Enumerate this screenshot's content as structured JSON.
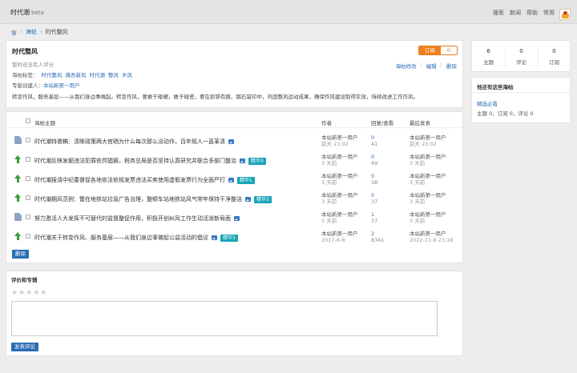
{
  "topbar": {
    "brand": "时代潮",
    "beta": "beta",
    "nav": [
      "搜索",
      "新闻",
      "帮助",
      "常用"
    ]
  },
  "breadcrumb": {
    "items": [
      "海帖",
      "时代整风"
    ],
    "separator": "›"
  },
  "group": {
    "title": "时代整风",
    "rating_text": "暂时还没有人评分",
    "tags_label": "海帖标签：",
    "tags": [
      "时代整风",
      "偶吾新风",
      "时代潮",
      "整风",
      "乡风"
    ],
    "creator_label": "专版创建人：",
    "creator": "本站新第一用户",
    "description": "转变作风，服务基层——从我们身边事做起。转变作风，要敢于碰硬，敢于碰瓷，要在抓铁有痕、踏石留印中，巩固整风运动成果，确保作风建设取得实效，持续改进工作作风。",
    "subscribe_label": "订阅",
    "subscribe_count": "0",
    "actions": [
      "海帖修改",
      "编辑",
      "删除"
    ]
  },
  "list": {
    "headers": {
      "topic": "海帖主题",
      "author": "作者",
      "replies": "回复/查看",
      "last": "最后发表"
    },
    "rows": [
      {
        "icon": "doc-icon",
        "title": "时代潮特邀稿：清晰政策两大官晒为什么每次那么没动作，百年规人一直革清",
        "badge": "",
        "author": "本站新第一用户",
        "author_time": "前天 23:02",
        "replies": "0",
        "views": "41",
        "last_user": "本站新第一用户",
        "last_time": "前天 23:02"
      },
      {
        "icon": "up-icon",
        "title": "时代潮反映发掘违法犯罪依然猖獗，税务总局是否坚持认真研究并联合多部门整治",
        "badge": "精华3",
        "author": "本站新第一用户",
        "author_time": "3 天前",
        "replies": "0",
        "views": "49",
        "last_user": "本站新第一用户",
        "last_time": "3 天前"
      },
      {
        "icon": "up-icon",
        "title": "时代潮报请中纪委督促各地依法依规发票违法买卖使用虚假发票行为全面严打",
        "badge": "精华1",
        "author": "本站新第一用户",
        "author_time": "3 天前",
        "replies": "0",
        "views": "38",
        "last_user": "本站新第一用户",
        "last_time": "3 天前"
      },
      {
        "icon": "up-icon",
        "title": "时代潮拥风范例：警在地铁站垃圾广告治理，整顿车站地铁站风气常年保持干净整洁",
        "badge": "精华3",
        "author": "本站新第一用户",
        "author_time": "3 天前",
        "replies": "0",
        "views": "37",
        "last_user": "本站新第一用户",
        "last_time": "3 天前"
      },
      {
        "icon": "doc-icon",
        "title": "努力激活人大发挥不可替代的监督整促作用，积极开创纠风工作生动活泼新局面",
        "badge": "",
        "author": "本站新第一用户",
        "author_time": "5 天前",
        "replies": "1",
        "views": "37",
        "last_user": "本站新第一用户",
        "last_time": "3 天前"
      },
      {
        "icon": "up-icon",
        "title": "时代潮关于转变作风、服务基层——从我们身边事做起公益活动的倡议",
        "badge": "精华3",
        "author": "本站新第一用户",
        "author_time": "2017-6-8",
        "replies": "2",
        "views": "8341",
        "last_user": "本站新第一用户",
        "last_time": "2022-11-8 23:18"
      }
    ],
    "delete_label": "删除"
  },
  "comment": {
    "title": "评价和专辑",
    "stars": 5,
    "placeholder": "",
    "submit_label": "发表评论"
  },
  "stats": [
    {
      "value": "6",
      "label": "主题"
    },
    {
      "value": "0",
      "label": "评论"
    },
    {
      "value": "0",
      "label": "订阅"
    }
  ],
  "related": {
    "title": "他还有这些海帖",
    "name": "精选必看",
    "meta": "主题 0，订阅 0，评论 0"
  }
}
